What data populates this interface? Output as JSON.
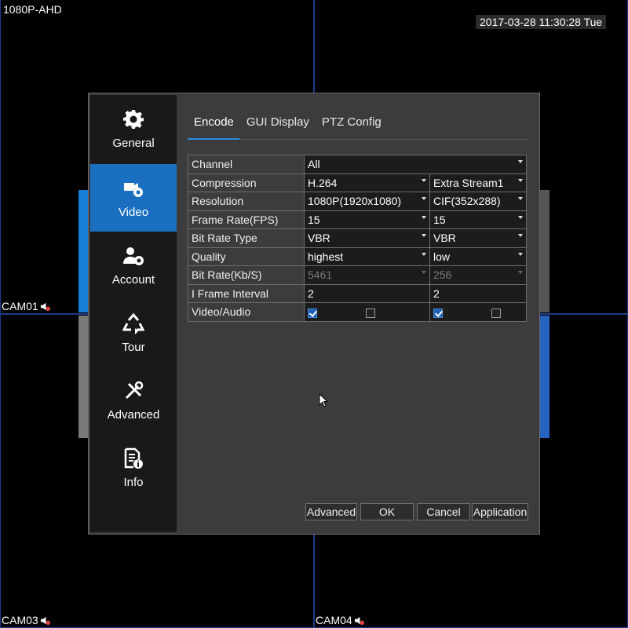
{
  "overlay": {
    "resolution_label": "1080P-AHD",
    "datetime": "2017-03-28 11:30:28 Tue",
    "cameras": [
      "CAM01",
      "CAM03",
      "CAM04"
    ]
  },
  "sidebar": {
    "items": [
      {
        "label": "General",
        "icon": "gear-icon"
      },
      {
        "label": "Video",
        "icon": "video-camera-gear-icon",
        "active": true
      },
      {
        "label": "Account",
        "icon": "user-gear-icon"
      },
      {
        "label": "Tour",
        "icon": "recycle-icon"
      },
      {
        "label": "Advanced",
        "icon": "tools-icon"
      },
      {
        "label": "Info",
        "icon": "info-document-icon"
      }
    ]
  },
  "tabs": [
    "Encode",
    "GUI Display",
    "PTZ Config"
  ],
  "active_tab": "Encode",
  "encode": {
    "channel": {
      "label": "Channel",
      "value": "All"
    },
    "rows": [
      {
        "label": "Compression",
        "main": "H.264",
        "extra": "Extra Stream1"
      },
      {
        "label": "Resolution",
        "main": "1080P(1920x1080)",
        "extra": "CIF(352x288)"
      },
      {
        "label": "Frame Rate(FPS)",
        "main": "15",
        "extra": "15"
      },
      {
        "label": "Bit Rate Type",
        "main": "VBR",
        "extra": "VBR"
      },
      {
        "label": "Quality",
        "main": "highest",
        "extra": "low"
      },
      {
        "label": "Bit Rate(Kb/S)",
        "main": "5461",
        "extra": "256"
      },
      {
        "label": "I Frame Interval",
        "main": "2",
        "extra": "2"
      }
    ],
    "video_audio": {
      "label": "Video/Audio",
      "main_video": true,
      "main_audio": false,
      "extra_video": true,
      "extra_audio": false
    }
  },
  "buttons": {
    "advanced": "Advanced",
    "ok": "OK",
    "cancel": "Cancel",
    "application": "Application"
  },
  "colors": {
    "accent": "#1a6fc0",
    "dialog_bg": "#3a3a3c",
    "sidebar_bg": "#1a1818"
  }
}
